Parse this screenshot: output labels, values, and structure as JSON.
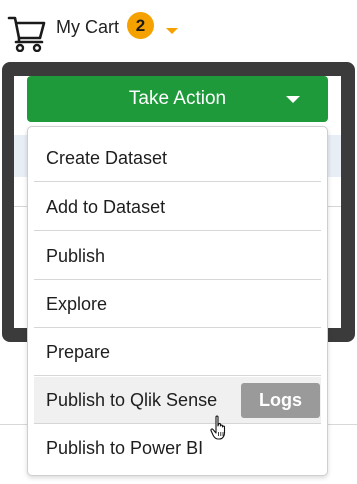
{
  "cart": {
    "label": "My Cart",
    "count": "2",
    "icon": "shopping-cart-icon",
    "accent_color": "#f5a200"
  },
  "take_action": {
    "label": "Take Action",
    "color": "#1f9a3b"
  },
  "menu": {
    "items": [
      {
        "label": "Create Dataset"
      },
      {
        "label": "Add to Dataset"
      },
      {
        "label": "Publish"
      },
      {
        "label": "Explore"
      },
      {
        "label": "Prepare"
      },
      {
        "label": "Publish to Qlik Sense",
        "action_label": "Logs",
        "hovered": true
      },
      {
        "label": "Publish to Power BI"
      }
    ]
  }
}
